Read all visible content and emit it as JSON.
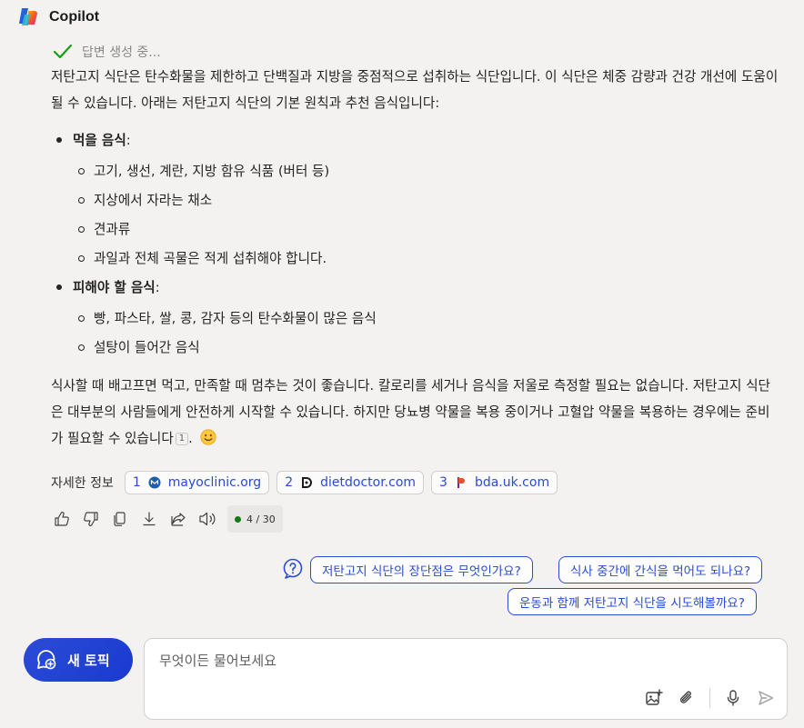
{
  "app": {
    "title": "Copilot"
  },
  "status": {
    "text": "답변 생성 중..."
  },
  "message": {
    "intro": "저탄고지 식단은 탄수화물을 제한하고 단백질과 지방을 중점적으로 섭취하는 식단입니다. 이 식단은 체중 감량과 건강 개선에 도움이 될 수 있습니다. 아래는 저탄고지 식단의 기본 원칙과 추천 음식입니다:",
    "sections": [
      {
        "title": "먹을 음식",
        "colon": ":",
        "items": [
          "고기, 생선, 계란, 지방 함유 식품 (버터 등)",
          "지상에서 자라는 채소",
          "견과류",
          "과일과 전체 곡물은 적게 섭취해야 합니다."
        ]
      },
      {
        "title": "피해야 할 음식",
        "colon": ":",
        "items": [
          "빵, 파스타, 쌀, 콩, 감자 등의 탄수화물이 많은 음식",
          "설탕이 들어간 음식"
        ]
      }
    ],
    "closing": "식사할 때 배고프면 먹고, 만족할 때 멈추는 것이 좋습니다. 칼로리를 세거나 음식을 저울로 측정할 필요는 없습니다. 저탄고지 식단은 대부분의 사람들에게 안전하게 시작할 수 있습니다. 하지만 당뇨병 약물을 복용 중이거나 고혈압 약물을 복용하는 경우에는 준비가 필요할 수 있습니다",
    "closing_citation": "1",
    "closing_end": "."
  },
  "sources": {
    "label": "자세한 정보",
    "items": [
      {
        "num": "1",
        "domain": "mayoclinic.org",
        "icon": "mayoclinic-icon"
      },
      {
        "num": "2",
        "domain": "dietdoctor.com",
        "icon": "dietdoctor-icon"
      },
      {
        "num": "3",
        "domain": "bda.uk.com",
        "icon": "bda-icon"
      }
    ]
  },
  "actions": {
    "icons": [
      "thumbs-up-icon",
      "thumbs-down-icon",
      "copy-icon",
      "download-icon",
      "share-icon",
      "read-aloud-icon"
    ],
    "turn_counter": "4 / 30"
  },
  "suggestions": [
    "저탄고지 식단의 장단점은 무엇인가요?",
    "식사 중간에 간식을 먹어도 되나요?",
    "운동과 함께 저탄고지 식단을 시도해볼까요?"
  ],
  "new_topic": {
    "label": "새 토픽"
  },
  "composer": {
    "placeholder": "무엇이든 물어보세요",
    "value": ""
  },
  "colors": {
    "accent": "#2b4bd6",
    "background": "#f3f2f1",
    "status_green": "#107c10"
  }
}
